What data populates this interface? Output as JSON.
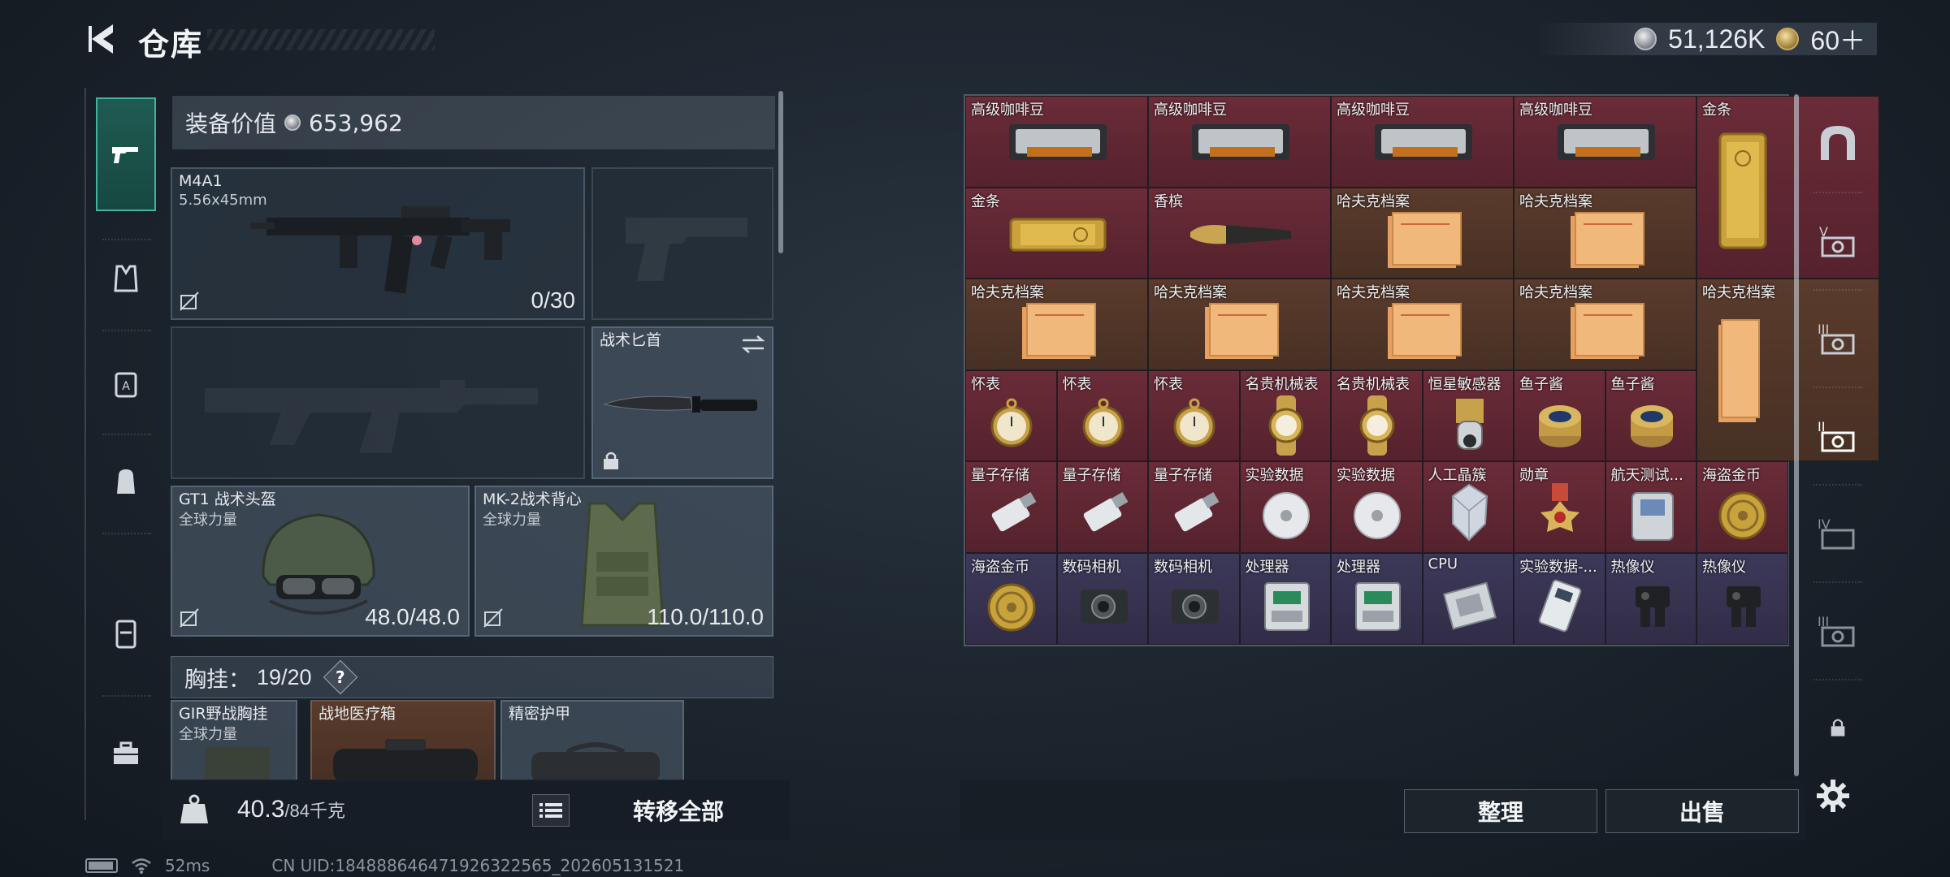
{
  "header": {
    "title": "仓库",
    "currency": [
      {
        "icon": "silver-coin-icon",
        "value": "51,126K"
      },
      {
        "icon": "gold-coin-icon",
        "value": "60＋"
      }
    ]
  },
  "left_nav": {
    "items": [
      {
        "name": "weapons",
        "icon": "pistol-icon",
        "active": true
      },
      {
        "name": "armor",
        "icon": "vest-icon"
      },
      {
        "name": "chest-rig",
        "icon": "rig-icon"
      },
      {
        "name": "backpack",
        "icon": "backpack-icon"
      },
      {
        "name": "pouch",
        "icon": "pouch-icon"
      },
      {
        "name": "toolbox",
        "icon": "toolbox-icon"
      }
    ]
  },
  "equipment": {
    "value_label": "装备价值",
    "value": "653,962",
    "primary_weapon": {
      "name": "M4A1",
      "caliber": "5.56x45mm",
      "ammo": "0/30"
    },
    "knife": {
      "name": "战术匕首"
    },
    "helmet": {
      "name": "GT1 战术头盔",
      "sub": "全球力量",
      "durability": "48.0/48.0"
    },
    "armor": {
      "name": "MK-2战术背心",
      "sub": "全球力量",
      "durability": "110.0/110.0"
    },
    "chest_rig": {
      "label": "胸挂：",
      "count": "19/20",
      "help": "?"
    },
    "rig_items": [
      {
        "name": "GIR野战胸挂",
        "sub": "全球力量"
      },
      {
        "name": "战地医疗箱"
      },
      {
        "name": "精密护甲"
      }
    ]
  },
  "bottom_left": {
    "weight_value": "40.3",
    "weight_max": "/84千克",
    "transfer_all": "转移全部"
  },
  "status": {
    "ping": "52ms",
    "uid": "CN UID:184888646471926322565_202605131521"
  },
  "storage": {
    "items": [
      {
        "name": "高级咖啡豆",
        "rarity": "red",
        "icon": "coffee-bag-icon"
      },
      {
        "name": "高级咖啡豆",
        "rarity": "red",
        "icon": "coffee-bag-icon"
      },
      {
        "name": "高级咖啡豆",
        "rarity": "red",
        "icon": "coffee-bag-icon"
      },
      {
        "name": "高级咖啡豆",
        "rarity": "red",
        "icon": "coffee-bag-icon"
      },
      {
        "name": "金条",
        "rarity": "red",
        "icon": "gold-bar-icon"
      },
      {
        "name": "金条",
        "rarity": "red",
        "icon": "gold-bar-icon"
      },
      {
        "name": "香槟",
        "rarity": "red",
        "icon": "champagne-icon"
      },
      {
        "name": "哈夫克档案",
        "rarity": "orange",
        "icon": "folder-icon"
      },
      {
        "name": "哈夫克档案",
        "rarity": "orange",
        "icon": "folder-icon"
      },
      {
        "name": "哈夫克档案",
        "rarity": "orange",
        "icon": "folder-icon"
      },
      {
        "name": "哈夫克档案",
        "rarity": "orange",
        "icon": "folder-icon"
      },
      {
        "name": "哈夫克档案",
        "rarity": "orange",
        "icon": "folder-icon"
      },
      {
        "name": "哈夫克档案",
        "rarity": "orange",
        "icon": "folder-icon"
      },
      {
        "name": "哈夫克档案",
        "rarity": "orange",
        "icon": "folder-icon"
      },
      {
        "name": "怀表",
        "rarity": "red",
        "icon": "pocket-watch-icon"
      },
      {
        "name": "怀表",
        "rarity": "red",
        "icon": "pocket-watch-icon"
      },
      {
        "name": "怀表",
        "rarity": "red",
        "icon": "pocket-watch-icon"
      },
      {
        "name": "名贵机械表",
        "rarity": "red",
        "icon": "wristwatch-icon"
      },
      {
        "name": "名贵机械表",
        "rarity": "red",
        "icon": "wristwatch-icon"
      },
      {
        "name": "恒星敏感器",
        "rarity": "red",
        "icon": "sensor-icon"
      },
      {
        "name": "鱼子酱",
        "rarity": "red",
        "icon": "caviar-tin-icon"
      },
      {
        "name": "鱼子酱",
        "rarity": "red",
        "icon": "caviar-tin-icon"
      },
      {
        "name": "量子存储",
        "rarity": "red",
        "icon": "usb-drive-icon"
      },
      {
        "name": "量子存储",
        "rarity": "red",
        "icon": "usb-drive-icon"
      },
      {
        "name": "量子存储",
        "rarity": "red",
        "icon": "usb-drive-icon"
      },
      {
        "name": "实验数据",
        "rarity": "red",
        "icon": "disc-icon"
      },
      {
        "name": "实验数据",
        "rarity": "red",
        "icon": "disc-icon"
      },
      {
        "name": "人工晶簇",
        "rarity": "red",
        "icon": "crystal-icon"
      },
      {
        "name": "勋章",
        "rarity": "red",
        "icon": "medal-icon"
      },
      {
        "name": "航天测试...",
        "rarity": "red",
        "icon": "test-device-icon"
      },
      {
        "name": "海盗金币",
        "rarity": "red",
        "icon": "pirate-coin-icon"
      },
      {
        "name": "海盗金币",
        "rarity": "purple",
        "icon": "pirate-coin-icon"
      },
      {
        "name": "数码相机",
        "rarity": "purple",
        "icon": "camera-icon"
      },
      {
        "name": "数码相机",
        "rarity": "purple",
        "icon": "camera-icon"
      },
      {
        "name": "处理器",
        "rarity": "purple",
        "icon": "processor-icon"
      },
      {
        "name": "处理器",
        "rarity": "purple",
        "icon": "processor-icon"
      },
      {
        "name": "CPU",
        "rarity": "purple",
        "icon": "cpu-icon"
      },
      {
        "name": "实验数据-...",
        "rarity": "purple",
        "icon": "data-drive-icon"
      },
      {
        "name": "热像仪",
        "rarity": "purple",
        "icon": "thermal-imager-icon"
      },
      {
        "name": "热像仪",
        "rarity": "purple",
        "icon": "thermal-imager-icon"
      }
    ]
  },
  "right_nav": {
    "items": [
      {
        "name": "vault",
        "icon": "vault-icon"
      },
      {
        "name": "storage-v",
        "icon": "storage-v-icon"
      },
      {
        "name": "storage-iii-a",
        "icon": "storage-iii-icon"
      },
      {
        "name": "storage-ii",
        "icon": "storage-ii-icon",
        "active": true
      },
      {
        "name": "storage-iv",
        "icon": "storage-iv-icon"
      },
      {
        "name": "storage-iii-b",
        "icon": "storage-iii-icon"
      },
      {
        "name": "locked",
        "icon": "lock-icon"
      }
    ]
  },
  "bottom_right": {
    "sort": "整理",
    "sell": "出售"
  },
  "colors": {
    "accent": "#3fb39e",
    "rarity_red": "#6a2c38",
    "rarity_orange": "#5a3b2c",
    "rarity_purple": "#3c3858"
  }
}
